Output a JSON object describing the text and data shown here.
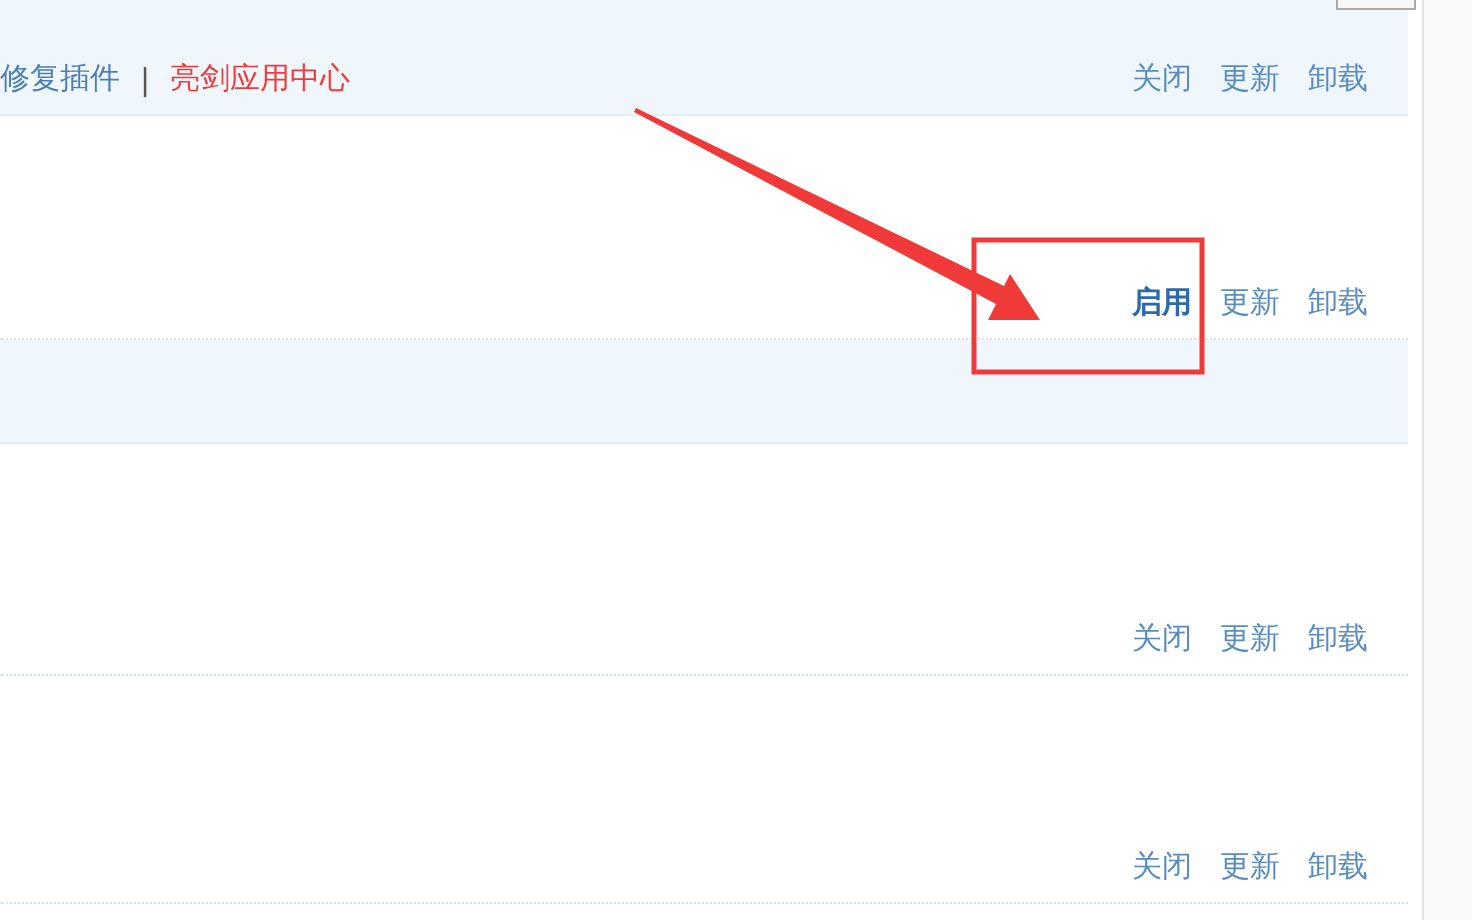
{
  "rows": [
    {
      "shaded": true,
      "links": [
        {
          "label": "修复插件",
          "kind": "link"
        },
        {
          "label": "|",
          "kind": "separator"
        },
        {
          "label": "亮剑应用中心",
          "kind": "hot"
        }
      ],
      "actions": [
        {
          "label": "关闭",
          "strong": false
        },
        {
          "label": "更新",
          "strong": false
        },
        {
          "label": "卸载",
          "strong": false
        }
      ]
    },
    {
      "shaded": false,
      "actions": [
        {
          "label": "启用",
          "strong": true
        },
        {
          "label": "更新",
          "strong": false
        },
        {
          "label": "卸载",
          "strong": false
        }
      ]
    },
    {
      "shaded": true,
      "actions": []
    },
    {
      "shaded": false,
      "actions": [
        {
          "label": "关闭",
          "strong": false
        },
        {
          "label": "更新",
          "strong": false
        },
        {
          "label": "卸载",
          "strong": false
        }
      ]
    },
    {
      "shaded": false,
      "actions": [
        {
          "label": "关闭",
          "strong": false
        },
        {
          "label": "更新",
          "strong": false
        },
        {
          "label": "卸载",
          "strong": false
        }
      ]
    }
  ]
}
